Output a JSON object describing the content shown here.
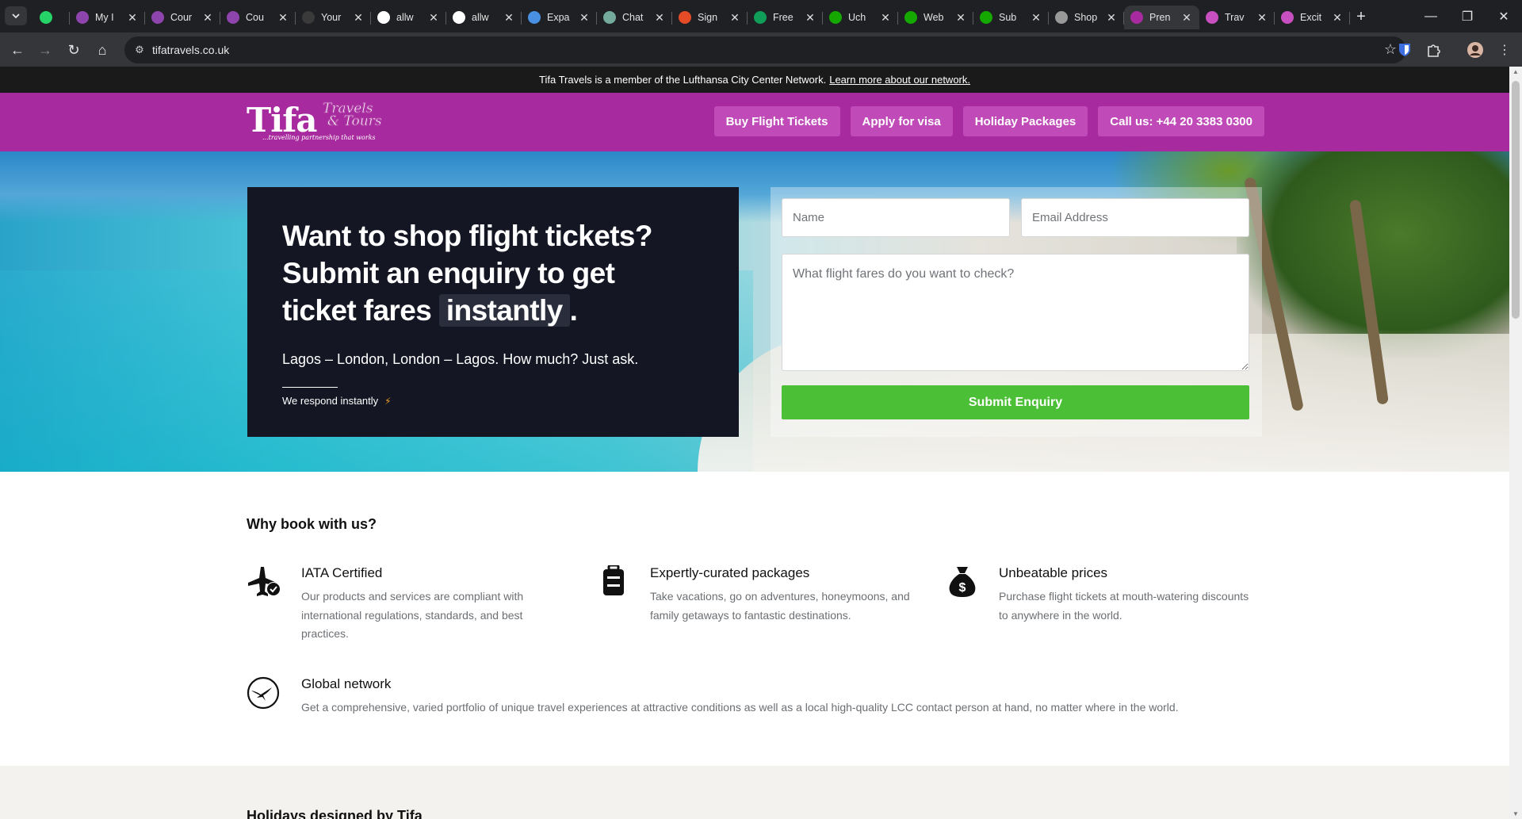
{
  "browser": {
    "tabs": [
      {
        "title": "",
        "icon": "whatsapp-icon",
        "color": "#25d366"
      },
      {
        "title": "My I",
        "icon": "upwork-u-icon",
        "color": "#8e44ad"
      },
      {
        "title": "Cour",
        "icon": "upwork-u-icon",
        "color": "#8e44ad"
      },
      {
        "title": "Cou",
        "icon": "upwork-u-icon",
        "color": "#8e44ad"
      },
      {
        "title": "Your",
        "icon": "github-icon",
        "color": "#3a3a3a"
      },
      {
        "title": "allw",
        "icon": "github-icon",
        "color": "#ffffff"
      },
      {
        "title": "allw",
        "icon": "github-icon",
        "color": "#ffffff"
      },
      {
        "title": "Expa",
        "icon": "puzzle-icon",
        "color": "#4a90e2"
      },
      {
        "title": "Chat",
        "icon": "chatgpt-icon",
        "color": "#74aa9c"
      },
      {
        "title": "Sign",
        "icon": "circle-icon",
        "color": "#e34c26"
      },
      {
        "title": "Free",
        "icon": "sheets-icon",
        "color": "#0f9d58"
      },
      {
        "title": "Uch",
        "icon": "upwork-icon",
        "color": "#14a800"
      },
      {
        "title": "Web",
        "icon": "upwork-icon",
        "color": "#14a800"
      },
      {
        "title": "Sub",
        "icon": "upwork-icon",
        "color": "#14a800"
      },
      {
        "title": "Shop",
        "icon": "rainbow-icon",
        "color": "#999999"
      },
      {
        "title": "Pren",
        "icon": "tifa-icon",
        "color": "#a72b9e"
      },
      {
        "title": "Trav",
        "icon": "t-icon",
        "color": "#c84fc0"
      },
      {
        "title": "Excit",
        "icon": "t-icon",
        "color": "#c84fc0"
      }
    ],
    "url": "tifatravels.co.uk"
  },
  "announcement": {
    "text": "Tifa Travels is a member of the Lufthansa City Center Network.",
    "link": "Learn more about our network."
  },
  "header": {
    "logo_main": "Tifa",
    "logo_secondary_1": "Travels",
    "logo_secondary_2": "& Tours",
    "logo_tagline": "...travelling partnership that works",
    "nav": [
      "Buy Flight Tickets",
      "Apply for visa",
      "Holiday Packages",
      "Call us: +44 20 3383 0300"
    ]
  },
  "hero": {
    "headline_1": "Want to shop flight tickets?",
    "headline_2": "Submit an enquiry to get",
    "headline_3": "ticket fares",
    "headline_highlight": "instantly",
    "headline_end": ".",
    "subtext": "Lagos – London, London – Lagos. How much? Just ask.",
    "respond_note": "We respond instantly",
    "form": {
      "name_placeholder": "Name",
      "email_placeholder": "Email Address",
      "message_placeholder": "What flight fares do you want to check?",
      "submit_label": "Submit Enquiry"
    }
  },
  "why": {
    "title": "Why book with us?",
    "features": [
      {
        "title": "IATA Certified",
        "text": "Our products and services are compliant with international regulations, standards, and best practices.",
        "icon": "plane-check-icon"
      },
      {
        "title": "Expertly-curated packages",
        "text": "Take vacations, go on adventures, honeymoons, and family getaways to fantastic destinations.",
        "icon": "luggage-icon"
      },
      {
        "title": "Unbeatable prices",
        "text": "Purchase flight tickets at mouth-watering discounts to anywhere in the world.",
        "icon": "money-bag-icon"
      },
      {
        "title": "Global network",
        "text": "Get a comprehensive, varied portfolio of unique travel experiences at attractive conditions as well as a local high-quality LCC contact person at hand, no matter where in the world.",
        "icon": "lufthansa-crane-icon"
      }
    ]
  },
  "holidays": {
    "title": "Holidays designed by Tifa"
  }
}
